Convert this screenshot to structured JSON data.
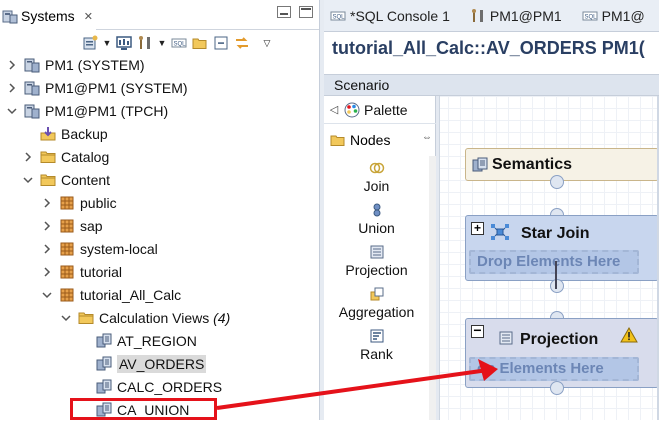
{
  "colors": {
    "highlight": "#e5121a",
    "selection": "#dadada",
    "title_blue": "#2a3f63",
    "drop_text": "#6c86b5"
  },
  "left": {
    "tab_title": "Systems",
    "tab_close": "✕",
    "toolbar_icons": [
      "new-system-icon",
      "dropdown-caret-icon",
      "monitor-icon",
      "tools-icon",
      "sql-icon",
      "folder-open-icon",
      "collapse-all-icon",
      "link-with-editor-icon",
      "view-menu-icon"
    ],
    "tree": [
      {
        "label": "PM1 (SYSTEM)",
        "icon": "system-icon",
        "expanded": false
      },
      {
        "label": "PM1@PM1 (SYSTEM)",
        "icon": "system-icon",
        "expanded": false
      },
      {
        "label": "PM1@PM1 (TPCH)",
        "icon": "system-icon",
        "expanded": true
      },
      {
        "label": "Backup",
        "icon": "backup-icon"
      },
      {
        "label": "Catalog",
        "icon": "folder-icon",
        "expanded": false
      },
      {
        "label": "Content",
        "icon": "folder-icon",
        "expanded": true
      },
      {
        "label": "public",
        "icon": "package-icon",
        "expanded": false
      },
      {
        "label": "sap",
        "icon": "package-icon",
        "expanded": false
      },
      {
        "label": "system-local",
        "icon": "package-icon",
        "expanded": false
      },
      {
        "label": "tutorial",
        "icon": "package-icon",
        "expanded": false
      },
      {
        "label": "tutorial_All_Calc",
        "icon": "package-icon",
        "expanded": true
      },
      {
        "label": "Calculation Views",
        "count": "(4)",
        "icon": "folder-icon",
        "expanded": true
      },
      {
        "label": "AT_REGION",
        "icon": "view-icon"
      },
      {
        "label": "AV_ORDERS",
        "icon": "view-icon",
        "selected": true
      },
      {
        "label": "CALC_ORDERS",
        "icon": "view-icon"
      },
      {
        "label": "CA_UNION",
        "icon": "view-icon",
        "highlighted": true
      }
    ]
  },
  "editor": {
    "tabs": [
      {
        "label": "*SQL Console 1",
        "icon": "sql-icon"
      },
      {
        "label": "PM1@PM1",
        "icon": "tools-icon"
      },
      {
        "label": "PM1@",
        "icon": "sql-icon"
      }
    ],
    "title": "tutorial_All_Calc::AV_ORDERS PM1(",
    "scenario_label": "Scenario",
    "palette": {
      "label": "Palette",
      "section": "Nodes",
      "items": [
        {
          "label": "Join",
          "icon": "join-icon"
        },
        {
          "label": "Union",
          "icon": "union-icon"
        },
        {
          "label": "Projection",
          "icon": "projection-icon"
        },
        {
          "label": "Aggregation",
          "icon": "aggregation-icon"
        },
        {
          "label": "Rank",
          "icon": "rank-icon"
        }
      ]
    },
    "canvas": {
      "nodes": [
        {
          "title": "Semantics",
          "icon": "semantics-icon"
        },
        {
          "title": "Star Join",
          "icon": "star-join-icon",
          "drop_text": "Drop Elements Here"
        },
        {
          "title": "Projection",
          "icon": "projection-icon",
          "drop_text": "op Elements Here",
          "warning": "warning-icon"
        }
      ]
    }
  }
}
